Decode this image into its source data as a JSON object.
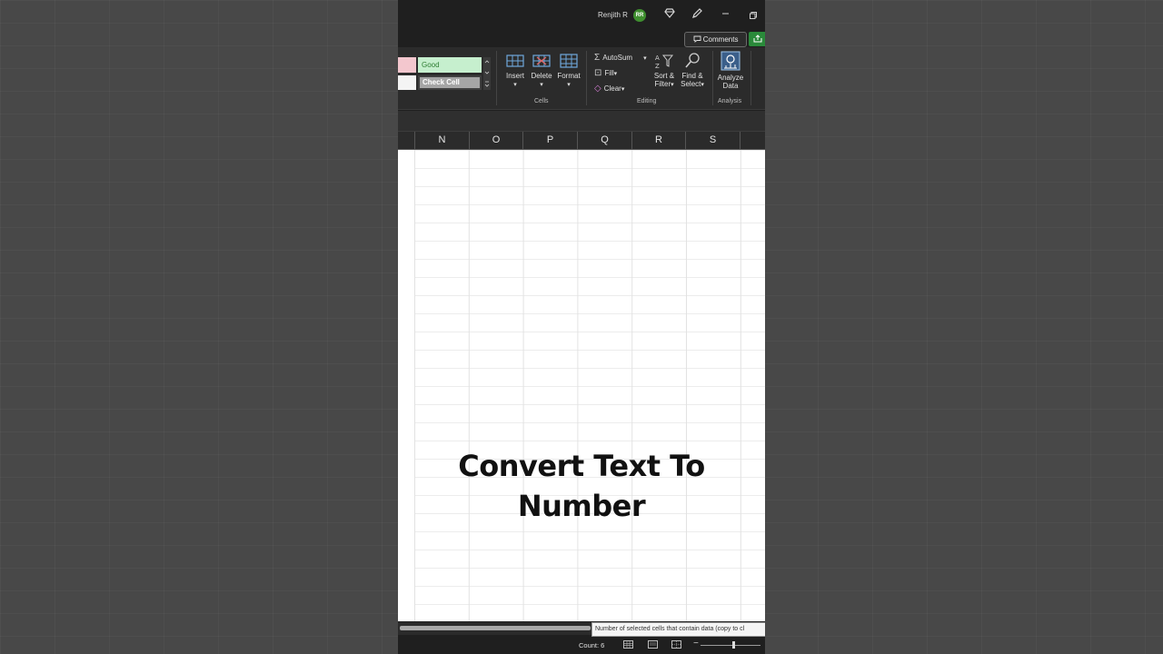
{
  "titlebar": {
    "user_name": "Renjith R",
    "avatar_initials": "RR",
    "icons": [
      "diamond-icon",
      "pen-icon",
      "minimize-icon",
      "restore-icon"
    ]
  },
  "comments": {
    "label": "Comments"
  },
  "styles": {
    "good": "Good",
    "check_cell": "Check Cell"
  },
  "cells_group": {
    "label": "Cells",
    "insert": "Insert",
    "delete": "Delete",
    "format": "Format"
  },
  "editing_group": {
    "label": "Editing",
    "autosum": "AutoSum",
    "fill": "Fill",
    "clear": "Clear",
    "sort_filter_1": "Sort &",
    "sort_filter_2": "Filter",
    "find_select_1": "Find &",
    "find_select_2": "Select"
  },
  "analysis_group": {
    "label": "Analysis",
    "analyze_1": "Analyze",
    "analyze_2": "Data"
  },
  "columns": [
    "N",
    "O",
    "P",
    "Q",
    "R",
    "S"
  ],
  "overlay": {
    "line1": "Convert Text To",
    "line2": "Number"
  },
  "tooltip": "Number of selected cells that contain data (copy to cl",
  "status": {
    "count": "Count: 6"
  },
  "colors": {
    "accent_green": "#2a8a3a",
    "good_fill": "#c6efce",
    "good_text": "#2e7d32"
  }
}
